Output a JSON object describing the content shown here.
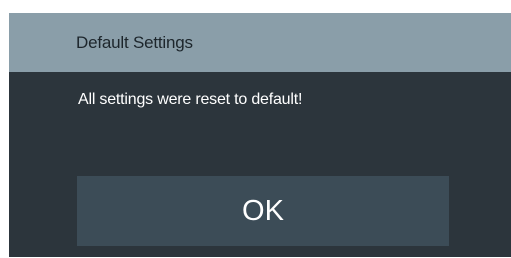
{
  "dialog": {
    "title": "Default Settings",
    "message": "All settings were reset to default!",
    "ok_label": "OK"
  },
  "colors": {
    "titlebar": "#8a9ea9",
    "body": "#2c353c",
    "button": "#3c4c57",
    "title_text": "#1d262c",
    "text": "#ffffff"
  }
}
